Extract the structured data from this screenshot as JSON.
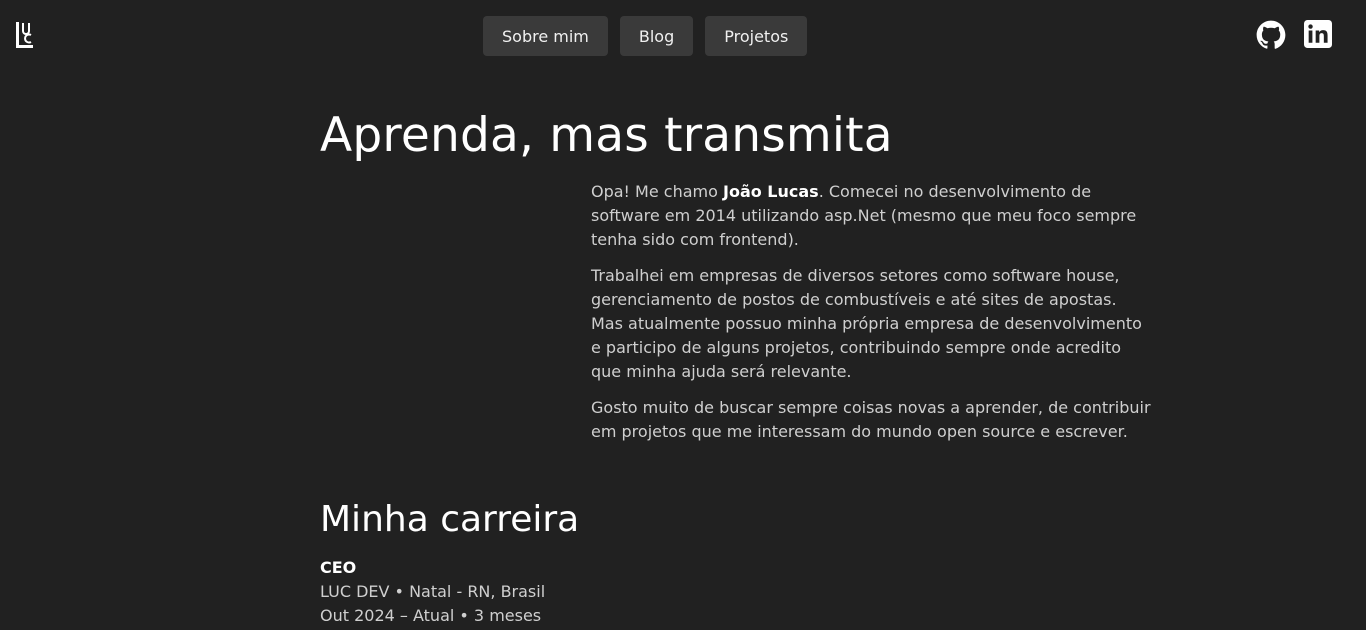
{
  "header": {
    "logo_alt": "LUC",
    "nav": [
      {
        "label": "Sobre mim"
      },
      {
        "label": "Blog"
      },
      {
        "label": "Projetos"
      }
    ],
    "social": [
      {
        "icon": "github-icon"
      },
      {
        "icon": "linkedin-icon"
      }
    ]
  },
  "hero": {
    "title": "Aprenda, mas transmita"
  },
  "about": {
    "p1_prefix": "Opa! Me chamo ",
    "p1_name": "João Lucas",
    "p1_suffix": ". Comecei no desenvolvimento de software em 2014 utilizando asp.Net (mesmo que meu foco sempre tenha sido com frontend).",
    "p2": "Trabalhei em empresas de diversos setores como software house, gerenciamento de postos de combustíveis e até sites de apostas. Mas atualmente possuo minha própria empresa de desenvolvimento e participo de alguns projetos, contribuindo sempre onde acredito que minha ajuda será relevante.",
    "p3": "Gosto muito de buscar sempre coisas novas a aprender, de contribuir em projetos que me interessam do mundo open source e escrever."
  },
  "career": {
    "title": "Minha carreira",
    "jobs": [
      {
        "role": "CEO",
        "company_location": "LUC DEV • Natal - RN, Brasil",
        "period": "Out 2024 – Atual • 3 meses"
      }
    ]
  },
  "colors": {
    "background": "#212121",
    "nav_button": "#3a3a3a",
    "text": "#cfcfcf",
    "heading": "#ffffff"
  }
}
